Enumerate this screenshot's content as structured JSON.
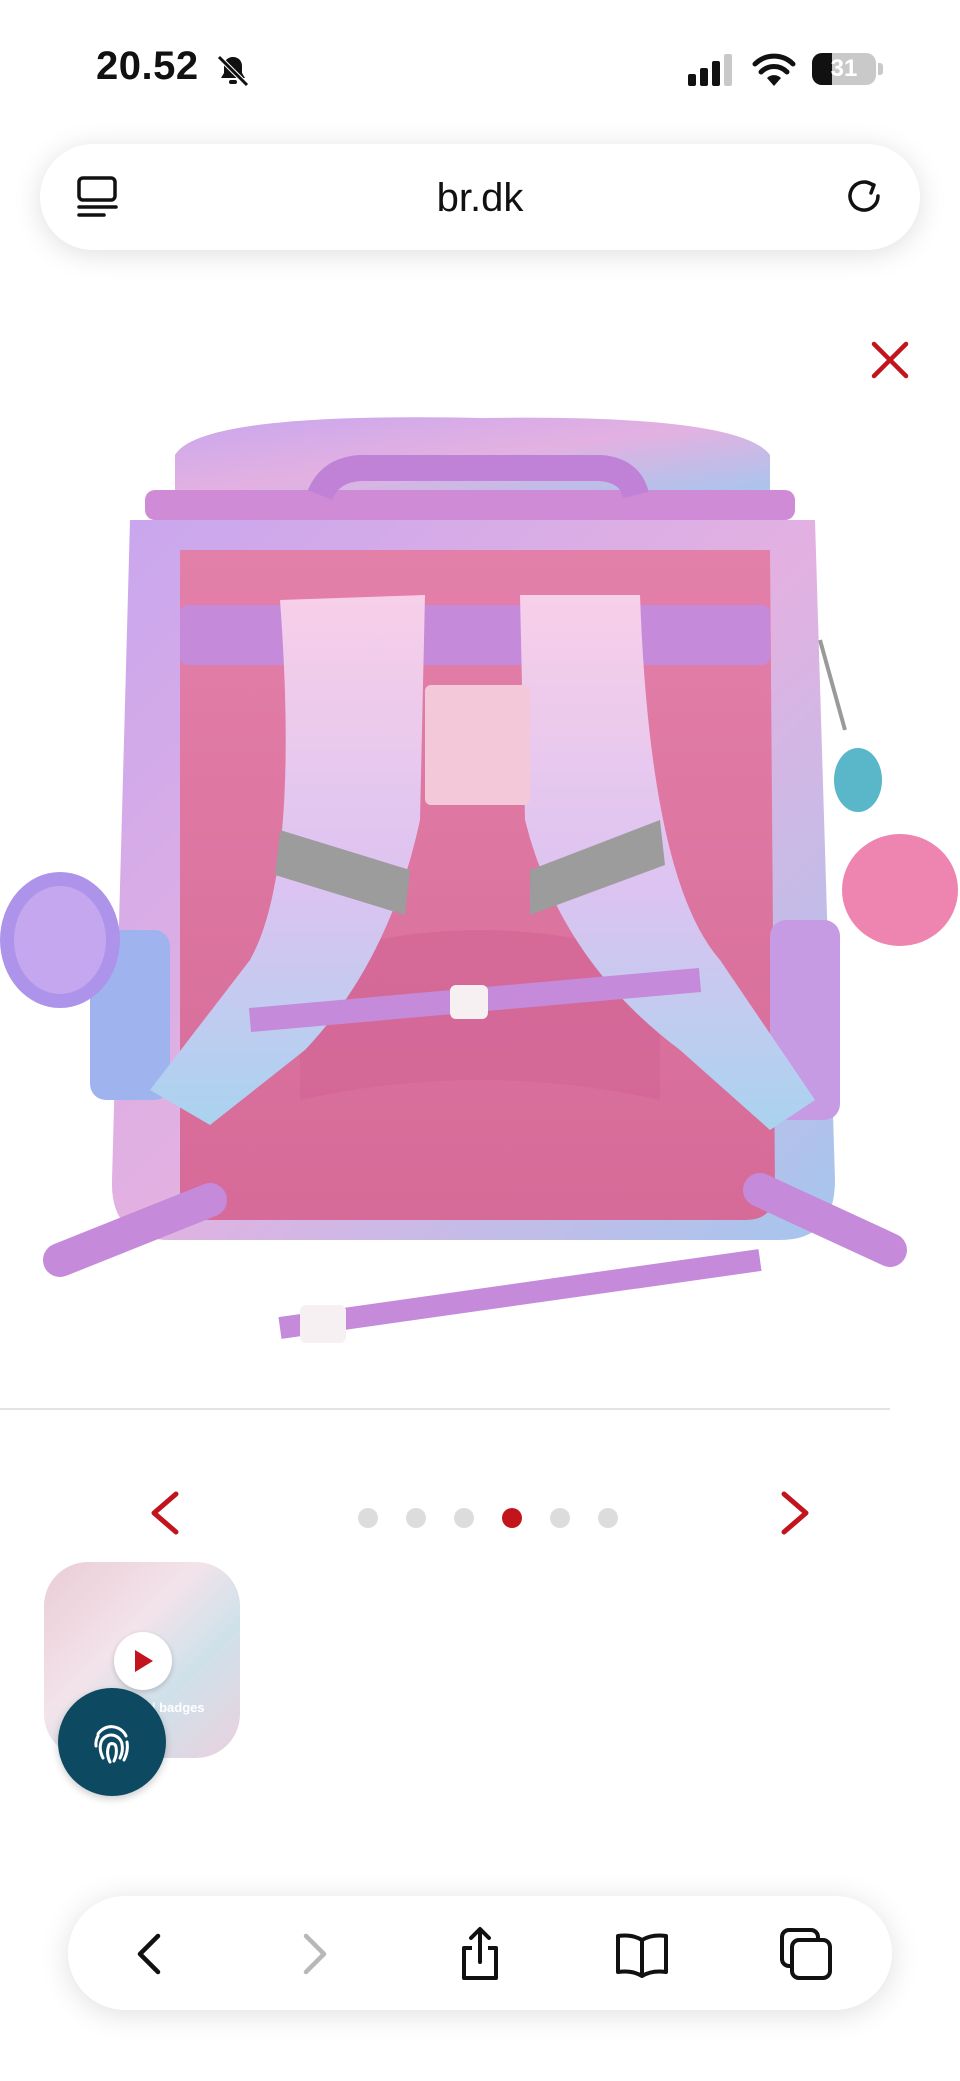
{
  "status_bar": {
    "time": "20.52",
    "battery_level": "31",
    "icons": [
      "bell-slash-icon",
      "signal-icon",
      "wifi-icon",
      "battery-icon"
    ]
  },
  "address_bar": {
    "domain": "br.dk",
    "left_icon": "reader-mode-icon",
    "right_icon": "reload-icon"
  },
  "gallery": {
    "close_icon": "close-icon",
    "image_description": "pink-purple school backpack with unicorn keychain, back view",
    "dot_count": 6,
    "active_dot_index": 3,
    "accent_color": "#c3141e",
    "thumbnail": {
      "caption": "ool badges",
      "icon": "play-icon"
    }
  },
  "floating_button": {
    "icon": "fingerprint-icon",
    "color": "#0d4a62"
  },
  "toolbar": {
    "items": [
      "back-icon",
      "forward-icon",
      "share-icon",
      "bookmarks-icon",
      "tabs-icon"
    ]
  }
}
